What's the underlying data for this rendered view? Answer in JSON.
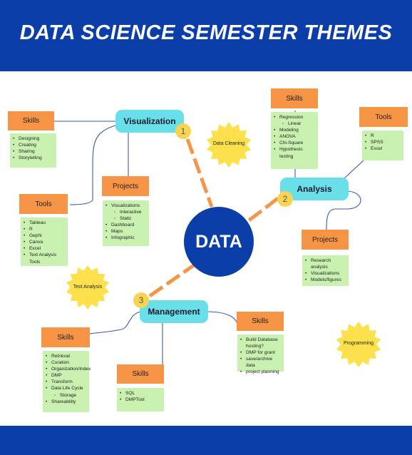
{
  "title": "DATA SCIENCE SEMESTER THEMES",
  "center": "DATA",
  "colors": {
    "banner": "#0b3ea8",
    "hub": "#69e0e9",
    "orange": "#f79546",
    "green": "#c9f2b0",
    "star": "#fde14c"
  },
  "visualization": {
    "label": "Visualization",
    "number": "1",
    "skills": {
      "title": "Skills",
      "items": [
        "Designing",
        "Creating",
        "Sharing",
        "Storytelling"
      ]
    },
    "tools": {
      "title": "Tools",
      "items": [
        "Tableau",
        "R",
        "Gephi",
        "Canva",
        "Excel",
        "Text Analysis Tools"
      ]
    },
    "projects": {
      "title": "Projects",
      "items": [
        "Visualizations",
        "Dashboard",
        "Maps",
        "Infographic"
      ],
      "sub_items": [
        "Interactive",
        "Static"
      ]
    }
  },
  "analysis": {
    "label": "Analysis",
    "number": "2",
    "skills": {
      "title": "Skills",
      "items": [
        "Regression",
        "Modeling",
        "ANOVA",
        "Chi-Square",
        "Hypothesis testing"
      ],
      "sub_items": [
        "Linear"
      ]
    },
    "tools": {
      "title": "Tools",
      "items": [
        "R",
        "SPSS",
        "Excel"
      ]
    },
    "projects": {
      "title": "Projects",
      "items": [
        "Research analysis",
        "Visualizations",
        "Models/figures"
      ]
    }
  },
  "management": {
    "label": "Management",
    "number": "3",
    "skills_right": {
      "title": "Skills",
      "items": [
        "Build Database hosting?",
        "DMP for grant",
        "save/archive data",
        "project planning"
      ]
    },
    "skills_left": {
      "title": "Skills",
      "items": [
        "Retrieval",
        "Curation",
        "Organization/Index",
        "DMP",
        "Transform",
        "Data Life Cycle",
        "Shareability"
      ],
      "sub_items": [
        "Storage"
      ]
    },
    "skills_bottom": {
      "title": "Skills",
      "items": [
        "SQL",
        "DMPTool"
      ]
    }
  },
  "callouts": {
    "data_cleaning": "Data Cleaning",
    "text_analysis": "Text Analysis",
    "programming": "Programming"
  }
}
